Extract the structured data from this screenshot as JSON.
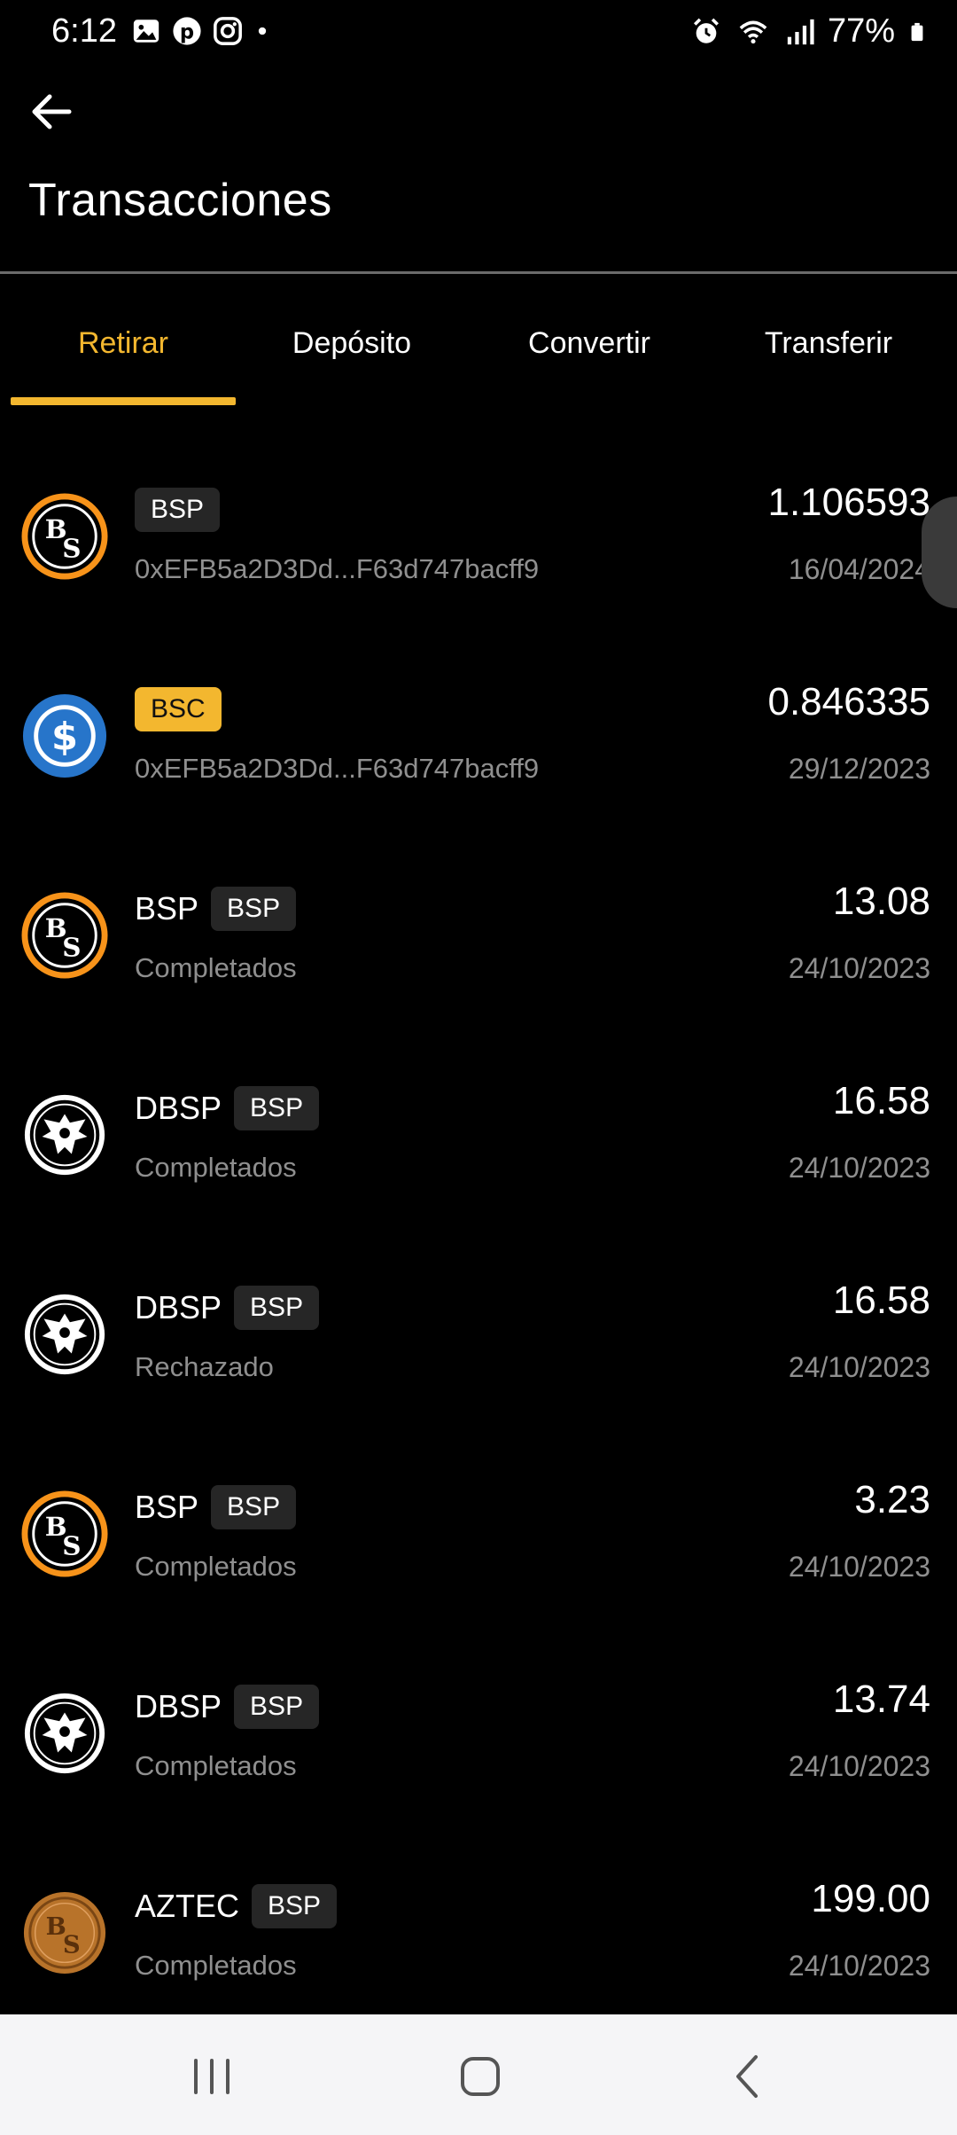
{
  "status_bar": {
    "time": "6:12",
    "battery": "77%",
    "left_icons": [
      "gallery-icon",
      "pinterest-icon",
      "instagram-icon",
      "dot-icon"
    ],
    "right_icons": [
      "alarm-icon",
      "wifi-icon",
      "signal-icon",
      "battery-icon"
    ]
  },
  "header": {
    "back_icon": "arrow-left-icon",
    "title": "Transacciones"
  },
  "tabs": [
    {
      "label": "Retirar",
      "active": true
    },
    {
      "label": "Depósito",
      "active": false
    },
    {
      "label": "Convertir",
      "active": false
    },
    {
      "label": "Transferir",
      "active": false
    }
  ],
  "transactions": [
    {
      "icon": "bsp-coin-icon",
      "name": "",
      "badge": "BSP",
      "badge_style": "dark",
      "subtitle": "0xEFB5a2D3Dd...F63d747bacff9",
      "amount": "1.106593",
      "date": "16/04/2024"
    },
    {
      "icon": "usdc-coin-icon",
      "name": "",
      "badge": "BSC",
      "badge_style": "yellow",
      "subtitle": "0xEFB5a2D3Dd...F63d747bacff9",
      "amount": "0.846335",
      "date": "29/12/2023"
    },
    {
      "icon": "bsp-coin-icon",
      "name": "BSP",
      "badge": "BSP",
      "badge_style": "dark",
      "subtitle": "Completados",
      "amount": "13.08",
      "date": "24/10/2023"
    },
    {
      "icon": "dbsp-eagle-icon",
      "name": "DBSP",
      "badge": "BSP",
      "badge_style": "dark",
      "subtitle": "Completados",
      "amount": "16.58",
      "date": "24/10/2023"
    },
    {
      "icon": "dbsp-eagle-icon",
      "name": "DBSP",
      "badge": "BSP",
      "badge_style": "dark",
      "subtitle": "Rechazado",
      "amount": "16.58",
      "date": "24/10/2023"
    },
    {
      "icon": "bsp-coin-icon",
      "name": "BSP",
      "badge": "BSP",
      "badge_style": "dark",
      "subtitle": "Completados",
      "amount": "3.23",
      "date": "24/10/2023"
    },
    {
      "icon": "dbsp-eagle-icon",
      "name": "DBSP",
      "badge": "BSP",
      "badge_style": "dark",
      "subtitle": "Completados",
      "amount": "13.74",
      "date": "24/10/2023"
    },
    {
      "icon": "aztec-coin-icon",
      "name": "AZTEC",
      "badge": "BSP",
      "badge_style": "dark",
      "subtitle": "Completados",
      "amount": "199.00",
      "date": "24/10/2023"
    }
  ],
  "nav_bar": {
    "buttons": [
      "recent-apps-icon",
      "home-icon",
      "back-nav-icon"
    ]
  },
  "colors": {
    "background": "#000000",
    "accent": "#f3b72f",
    "muted_text": "#8f8f8f",
    "badge_bg": "#262626",
    "usdc_blue": "#2775ca",
    "bsp_ring": "#f7931a",
    "aztec_bronze": "#b8732a"
  }
}
